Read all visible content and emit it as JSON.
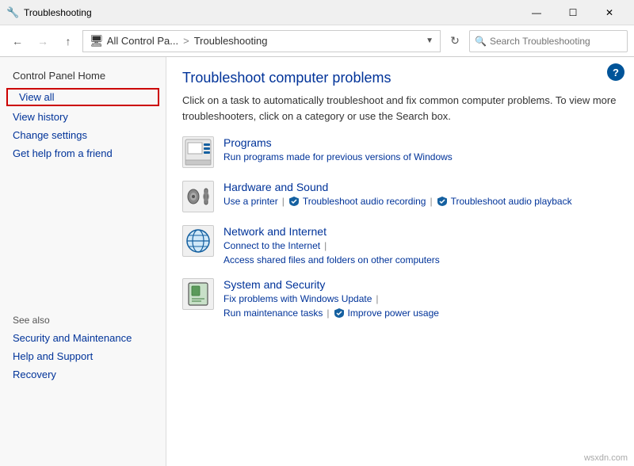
{
  "titleBar": {
    "icon": "🔧",
    "title": "Troubleshooting",
    "minimizeLabel": "—",
    "maximizeLabel": "☐",
    "closeLabel": "✕"
  },
  "addressBar": {
    "backDisabled": false,
    "forwardDisabled": true,
    "upDisabled": false,
    "pathIcon": "🖥",
    "pathPrefix": "All Control Pa...",
    "pathSep": ">",
    "pathCurrent": "Troubleshooting",
    "searchPlaceholder": "Search Troubleshooting"
  },
  "sidebar": {
    "homeLabel": "Control Panel Home",
    "links": [
      {
        "id": "view-all",
        "label": "View all",
        "highlighted": true
      },
      {
        "id": "view-history",
        "label": "View history",
        "highlighted": false
      },
      {
        "id": "change-settings",
        "label": "Change settings",
        "highlighted": false
      },
      {
        "id": "get-help",
        "label": "Get help from a friend",
        "highlighted": false
      }
    ],
    "seeAlsoTitle": "See also",
    "seeAlsoLinks": [
      {
        "id": "security",
        "label": "Security and Maintenance"
      },
      {
        "id": "help-support",
        "label": "Help and Support"
      },
      {
        "id": "recovery",
        "label": "Recovery"
      }
    ]
  },
  "content": {
    "title": "Troubleshoot computer problems",
    "description": "Click on a task to automatically troubleshoot and fix common computer problems. To view more troubleshooters, click on a category or use the Search box.",
    "helpBtn": "?",
    "categories": [
      {
        "id": "programs",
        "title": "Programs",
        "iconText": "📋",
        "links": [
          {
            "id": "run-programs",
            "label": "Run programs made for previous versions of Windows",
            "hasShield": false
          }
        ]
      },
      {
        "id": "hardware-sound",
        "title": "Hardware and Sound",
        "iconText": "🔊",
        "links": [
          {
            "id": "use-printer",
            "label": "Use a printer",
            "hasShield": false,
            "sep": true
          },
          {
            "id": "troubleshoot-audio-rec",
            "label": "Troubleshoot audio recording",
            "hasShield": true,
            "sep": true
          },
          {
            "id": "troubleshoot-audio-play",
            "label": "Troubleshoot audio playback",
            "hasShield": true,
            "sep": false
          }
        ]
      },
      {
        "id": "network-internet",
        "title": "Network and Internet",
        "iconText": "🌐",
        "links": [
          {
            "id": "connect-internet",
            "label": "Connect to the Internet",
            "hasShield": false,
            "sep": true
          },
          {
            "id": "access-shared",
            "label": "Access shared files and folders on other computers",
            "hasShield": false,
            "sep": false
          }
        ]
      },
      {
        "id": "system-security",
        "title": "System and Security",
        "iconText": "🛡",
        "links": [
          {
            "id": "fix-windows-update",
            "label": "Fix problems with Windows Update",
            "hasShield": false,
            "sep": true
          },
          {
            "id": "run-maintenance",
            "label": "Run maintenance tasks",
            "hasShield": false,
            "sep": true
          },
          {
            "id": "improve-power",
            "label": "Improve power usage",
            "hasShield": true,
            "sep": false
          }
        ]
      }
    ]
  },
  "watermark": "wsxdn.com"
}
